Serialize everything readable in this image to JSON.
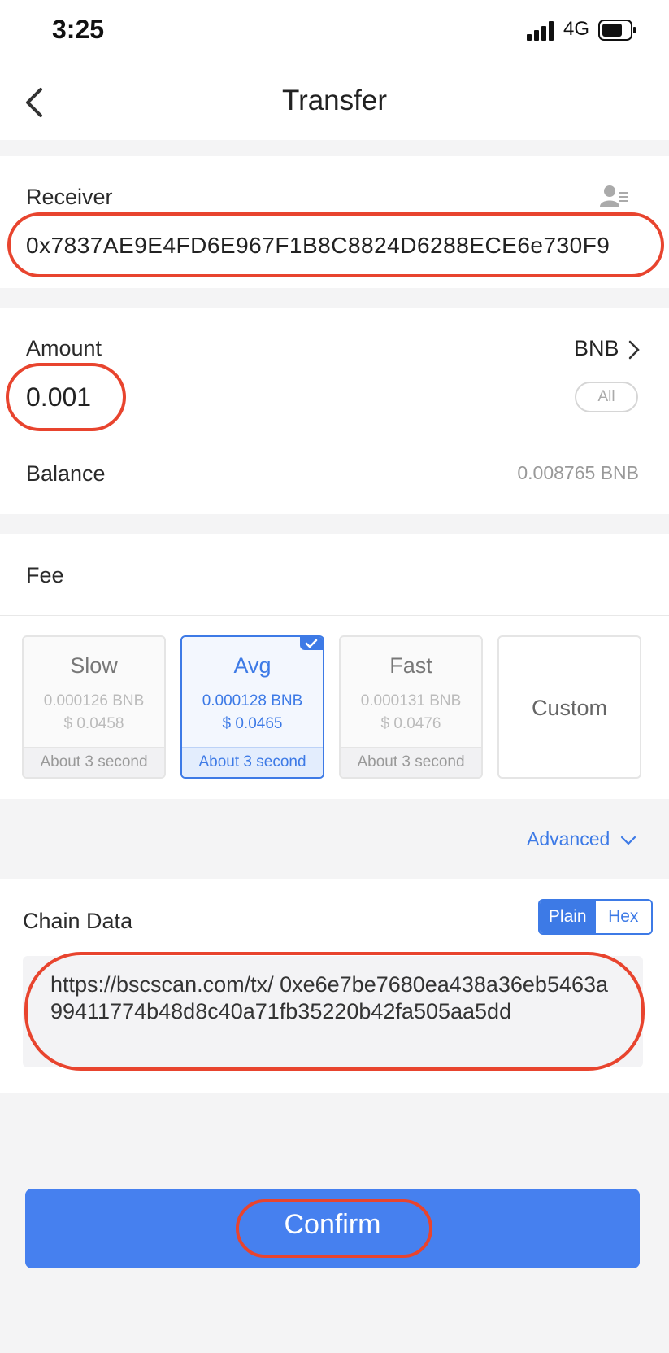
{
  "status_bar": {
    "time": "3:25",
    "network": "4G"
  },
  "nav": {
    "title": "Transfer"
  },
  "receiver": {
    "label": "Receiver",
    "address": "0x7837AE9E4FD6E967F1B8C8824D6288ECE6e730F9"
  },
  "amount": {
    "label": "Amount",
    "token": "BNB",
    "value": "0.001",
    "all_label": "All"
  },
  "balance": {
    "label": "Balance",
    "value": "0.008765 BNB"
  },
  "fee": {
    "label": "Fee",
    "options": [
      {
        "name": "Slow",
        "bnb": "0.000126 BNB",
        "usd": "$ 0.0458",
        "time": "About 3 second"
      },
      {
        "name": "Avg",
        "bnb": "0.000128 BNB",
        "usd": "$ 0.0465",
        "time": "About 3 second"
      },
      {
        "name": "Fast",
        "bnb": "0.000131 BNB",
        "usd": "$ 0.0476",
        "time": "About 3 second"
      }
    ],
    "custom_label": "Custom",
    "selected": "Avg"
  },
  "advanced": {
    "label": "Advanced"
  },
  "chain_data": {
    "label": "Chain Data",
    "mode_plain": "Plain",
    "mode_hex": "Hex",
    "value": "https://bscscan.com/tx/ 0xe6e7be7680ea438a36eb5463a99411774b48d8c40a71fb35220b42fa505aa5dd"
  },
  "confirm": {
    "label": "Confirm"
  },
  "colors": {
    "accent": "#4680ef",
    "highlight_ring": "#e8442e"
  }
}
